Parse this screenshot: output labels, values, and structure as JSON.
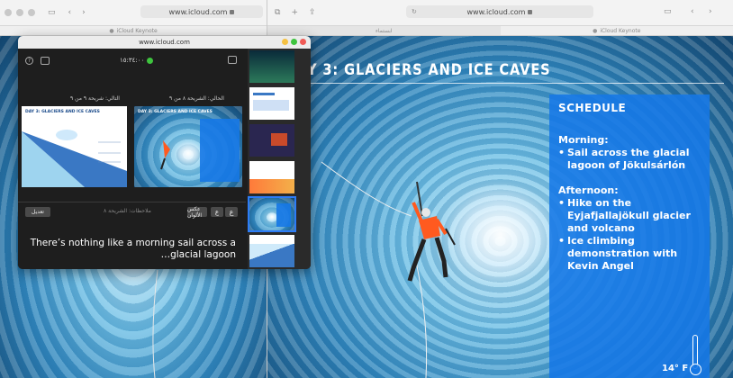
{
  "left_window": {
    "url": "www.icloud.com",
    "tab_label": "iCloud Keynote"
  },
  "right_window": {
    "url": "www.icloud.com",
    "tab_left_label": "ابستماء",
    "tab_right_label": "iCloud Keynote"
  },
  "slide": {
    "title": "Y 3: GLACIERS AND ICE CAVES",
    "schedule_heading": "SCHEDULE",
    "morning_heading": "Morning:",
    "morning_items": [
      "Sail across the glacial lagoon of Jökulsárlón"
    ],
    "afternoon_heading": "Afternoon:",
    "afternoon_items": [
      "Hike on the Eyjafjallajökull glacier and volcano",
      "Ice climbing demonstration with Kevin Angel"
    ],
    "temperature": "14° F"
  },
  "presenter": {
    "window_url": "www.icloud.com",
    "timer": "١٥:٣٤:٠٠",
    "next_label": "التالي: شريحة ٩ من ٩",
    "current_label": "الحالي: الشريحة ٨ من ٩",
    "next_thumb_title": "DAY 3: GLACIERS AND ICE CAVES",
    "current_thumb_title": "DAY 3: GLACIERS AND ICE CAVES",
    "edit_button": "تعديل",
    "invert_colors_button": "عكس الألوان",
    "font_smaller_button": "ع",
    "font_larger_button": "ع",
    "notes_label": "ملاحظات: الشريحة ٨",
    "notes_text": "There’s nothing like a morning sail across a glacial lagoon…"
  },
  "colors": {
    "accent": "#2d7cf6",
    "schedule_bg": "#1678e6",
    "timer_dot": "#3ec43e"
  }
}
